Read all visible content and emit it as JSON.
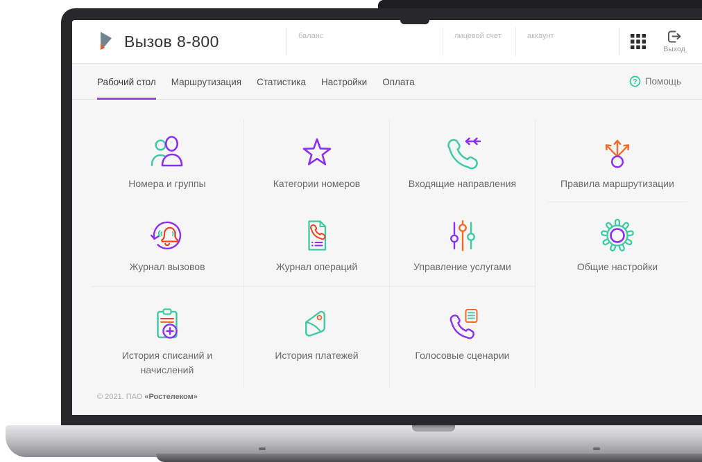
{
  "header": {
    "title": "Вызов 8-800",
    "logo_icon": "rostelecom-logo-icon",
    "fields": [
      {
        "label": "баланс"
      },
      {
        "label": "лицевой счет"
      },
      {
        "label": "аккаунт"
      }
    ],
    "apps_icon": "grid-apps-icon",
    "logout": {
      "label": "Выход",
      "icon": "logout-icon"
    }
  },
  "nav": {
    "tabs": [
      {
        "label": "Рабочий стол",
        "active": true
      },
      {
        "label": "Маршрутизация",
        "active": false
      },
      {
        "label": "Статистика",
        "active": false
      },
      {
        "label": "Настройки",
        "active": false
      },
      {
        "label": "Оплата",
        "active": false
      }
    ],
    "help": {
      "label": "Помощь",
      "icon": "question-circle-icon"
    }
  },
  "tiles": [
    {
      "label": "Номера и группы",
      "icon": "people-icon"
    },
    {
      "label": "Категории номеров",
      "icon": "star-icon"
    },
    {
      "label": "Входящие направления",
      "icon": "incoming-phone-icon"
    },
    {
      "label": "Правила маршрутизации",
      "icon": "routing-arrows-icon"
    },
    {
      "label": "Журнал вызовов",
      "icon": "bell-refresh-icon"
    },
    {
      "label": "Журнал операций",
      "icon": "document-phone-icon"
    },
    {
      "label": "Управление услугами",
      "icon": "sliders-icon"
    },
    {
      "label": "Общие настройки",
      "icon": "gear-icon"
    },
    {
      "label": "История списаний и начислений",
      "icon": "clipboard-plus-icon"
    },
    {
      "label": "История платежей",
      "icon": "wallet-icon"
    },
    {
      "label": "Голосовые сценарии",
      "icon": "voice-script-phone-icon"
    }
  ],
  "footer": {
    "copyright": "© 2021. ПАО ",
    "company": "«Ростелеком»"
  },
  "colors": {
    "purple": "#8c2ff2",
    "green": "#3fc9a4",
    "orange": "#f2692c",
    "red_orange": "#ee4326",
    "tab_underline": "#9146e0",
    "help_green": "#2cc98f",
    "logo_slate": "#72858f",
    "logo_orange": "#f05323"
  }
}
